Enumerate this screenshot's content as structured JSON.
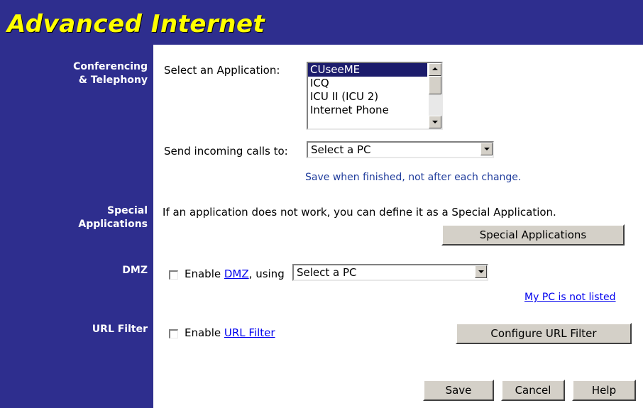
{
  "header": {
    "title": "Advanced Internet"
  },
  "sidebar": {
    "conferencing_line1": "Conferencing",
    "conferencing_line2": "& Telephony",
    "special_line1": "Special",
    "special_line2": "Applications",
    "dmz": "DMZ",
    "url_filter": "URL Filter"
  },
  "conferencing": {
    "select_app_label": "Select an Application:",
    "applications": [
      "CUseeME",
      "ICQ",
      "ICU II (ICU 2)",
      "Internet Phone"
    ],
    "selected_application": "CUseeME",
    "send_calls_label": "Send incoming calls to:",
    "send_calls_value": "Select a PC",
    "save_note": "Save when finished, not after each change."
  },
  "special": {
    "description": "If an application does not work, you can define it as a Special Application.",
    "button_label": "Special Applications"
  },
  "dmz": {
    "enable_prefix": "Enable ",
    "link_text": "DMZ",
    "using_text": ", using",
    "select_value": "Select a PC",
    "enabled": false,
    "not_listed_link": "My PC is not listed"
  },
  "url_filter": {
    "enable_prefix": "Enable ",
    "link_text": "URL Filter",
    "enabled": false,
    "configure_button": "Configure URL Filter"
  },
  "footer": {
    "save": "Save",
    "cancel": "Cancel",
    "help": "Help"
  },
  "colors": {
    "header_bg": "#2e2e8e",
    "title": "#ffff00",
    "note": "#1f3c9c",
    "link": "#0000ee"
  }
}
